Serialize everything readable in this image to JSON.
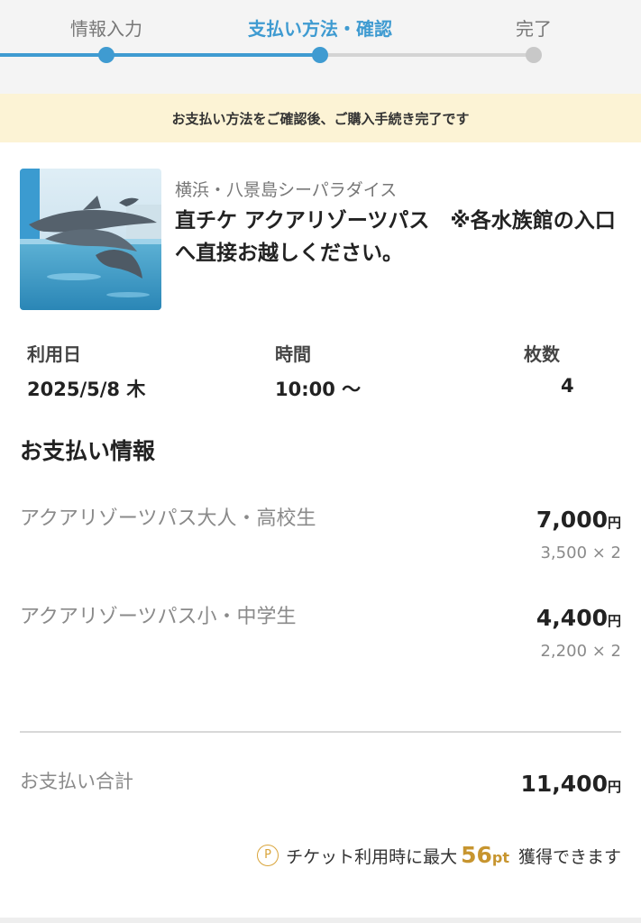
{
  "stepper": {
    "steps": [
      {
        "label": "情報入力",
        "state": "done"
      },
      {
        "label": "支払い方法・確認",
        "state": "active"
      },
      {
        "label": "完了",
        "state": "todo"
      }
    ],
    "active_color": "#3f9bd1"
  },
  "notice": "お支払い方法をご確認後、ご購入手続き完了です",
  "product": {
    "venue": "横浜・八景島シーパラダイス",
    "title": "直チケ アクアリゾーツパス　※各水族館の入口へ直接お越しください。",
    "image": "dolphin-show-photo"
  },
  "usage": {
    "date_label": "利用日",
    "date_value": "2025/5/8 木",
    "time_label": "時間",
    "time_value": "10:00 〜",
    "qty_label": "枚数",
    "qty_value": "4"
  },
  "payment": {
    "section_title": "お支払い情報",
    "items": [
      {
        "name": "アクアリゾーツパス大人・高校生",
        "amount": "7,000",
        "currency": "円",
        "calc": "3,500 × 2"
      },
      {
        "name": "アクアリゾーツパス小・中学生",
        "amount": "4,400",
        "currency": "円",
        "calc": "2,200 × 2"
      }
    ],
    "total_label": "お支払い合計",
    "total_amount": "11,400",
    "total_currency": "円"
  },
  "points": {
    "icon_letter": "P",
    "prefix": "チケット利用時に最大",
    "value": "56",
    "unit": "pt",
    "suffix": "獲得できます",
    "color": "#c7952f"
  }
}
